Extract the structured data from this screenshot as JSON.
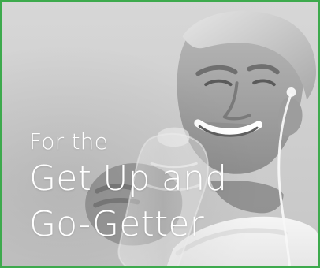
{
  "card": {
    "accent_color": "#3daa4d"
  },
  "headline": {
    "small": "For the",
    "line1": "Get Up and",
    "line2": "Go-Getter"
  },
  "image": {
    "subject_icon": "man-drinking-water-icon"
  }
}
